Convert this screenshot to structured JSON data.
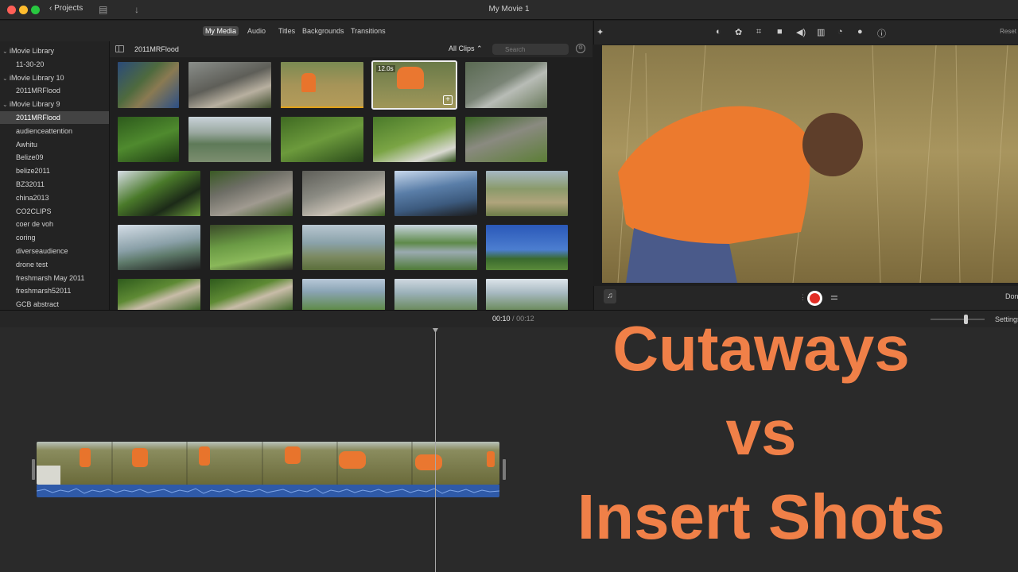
{
  "window": {
    "title": "My Movie 1",
    "back_label": "Projects"
  },
  "browser_tabs": [
    "My Media",
    "Audio",
    "Titles",
    "Backgrounds",
    "Transitions"
  ],
  "active_tab": "My Media",
  "sidebar": {
    "items": [
      {
        "label": "iMovie Library",
        "level": 0,
        "expanded": true
      },
      {
        "label": "11-30-20",
        "level": 1
      },
      {
        "label": "iMovie Library 10",
        "level": 0,
        "expanded": true
      },
      {
        "label": "2011MRFlood",
        "level": 1
      },
      {
        "label": "iMovie Library 9",
        "level": 0,
        "expanded": true
      },
      {
        "label": "2011MRFlood",
        "level": 1,
        "selected": true
      },
      {
        "label": "audienceattention",
        "level": 1
      },
      {
        "label": "Awhitu",
        "level": 1
      },
      {
        "label": "Belize09",
        "level": 1
      },
      {
        "label": "belize2011",
        "level": 1
      },
      {
        "label": "BZ32011",
        "level": 1
      },
      {
        "label": "china2013",
        "level": 1
      },
      {
        "label": "CO2CLIPS",
        "level": 1
      },
      {
        "label": "coer de voh",
        "level": 1
      },
      {
        "label": "coring",
        "level": 1
      },
      {
        "label": "diverseaudience",
        "level": 1
      },
      {
        "label": "drone test",
        "level": 1
      },
      {
        "label": "freshmarsh May 2011",
        "level": 1
      },
      {
        "label": "freshmarsh52011",
        "level": 1
      },
      {
        "label": "GCB abstract",
        "level": 1
      }
    ]
  },
  "browser": {
    "event_title": "2011MRFlood",
    "filter_label": "All Clips",
    "search_placeholder": "Search",
    "selected_clip_duration": "12.0s"
  },
  "viewer": {
    "reset_label": "Reset",
    "done_label": "Done"
  },
  "timeline": {
    "current_time": "00:10",
    "separator": "/",
    "total_time": "00:12",
    "settings_label": "Settings"
  },
  "overlay": {
    "line1": "Cutaways",
    "line2": "vs",
    "line3": "Insert Shots"
  },
  "colors": {
    "accent_orange": "#f08048",
    "record_red": "#e22d25",
    "audio_blue": "#2f5aa8",
    "selection_bar": "#e0a21b"
  },
  "icons": [
    "magic-wand",
    "color-balance",
    "color-correction",
    "crop",
    "stabilization",
    "volume",
    "noise-reduction",
    "speed",
    "clip-filter",
    "info",
    "microphone",
    "record",
    "voiceover-options"
  ]
}
